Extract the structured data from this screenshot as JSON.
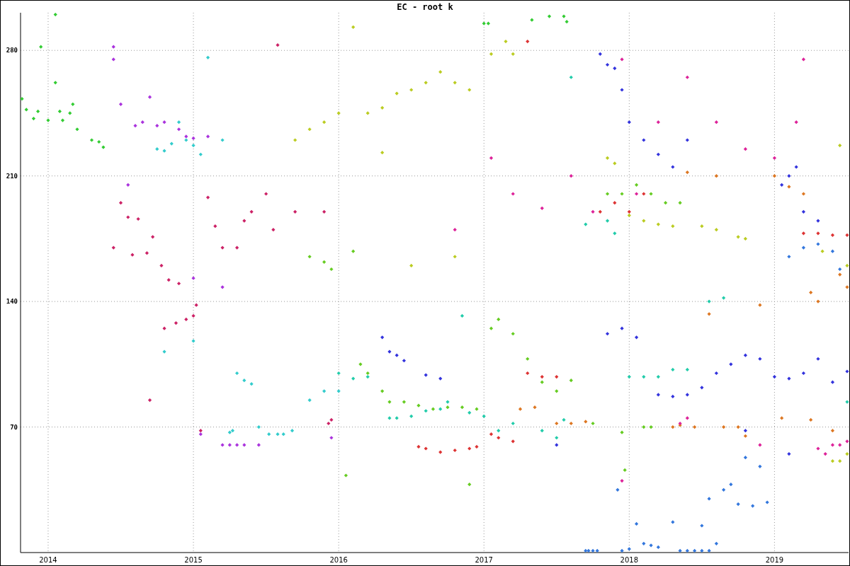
{
  "chart_data": {
    "type": "scatter",
    "title": "EC - root k",
    "xlim": [
      2013.81,
      2019.51
    ],
    "ylim": [
      0,
      301
    ],
    "grid": true,
    "xticks": [
      2014,
      2015,
      2016,
      2017,
      2018,
      2019
    ],
    "yticks": [
      70,
      140,
      210,
      280
    ],
    "series": [
      {
        "color": "#33cc33",
        "x": [
          2013.82,
          2013.85,
          2013.9,
          2013.93,
          2013.95,
          2014.0,
          2014.05,
          2014.1,
          2014.15,
          2014.2,
          2014.08,
          2014.17,
          2014.3,
          2014.35,
          2014.38,
          2014.05,
          2017.0,
          2017.03,
          2017.33,
          2017.45,
          2017.55,
          2017.57
        ],
        "values": [
          253,
          247,
          242,
          246,
          282,
          241,
          300,
          241,
          245,
          236,
          246,
          250,
          230,
          229,
          226,
          262,
          295,
          295,
          297,
          299,
          299,
          296
        ]
      },
      {
        "color": "#aa33dd",
        "x": [
          2014.45,
          2014.45,
          2014.5,
          2014.55,
          2014.6,
          2014.65,
          2014.7,
          2014.75,
          2014.8,
          2014.9,
          2014.95,
          2015.0,
          2015.1,
          2015.0,
          2015.2,
          2015.2,
          2015.25,
          2015.3,
          2015.35,
          2015.45,
          2015.05,
          2015.95
        ],
        "values": [
          275,
          282,
          250,
          205,
          238,
          240,
          254,
          238,
          240,
          236,
          232,
          231,
          232,
          153,
          148,
          60,
          60,
          60,
          60,
          60,
          66,
          64
        ]
      },
      {
        "color": "#cc2266",
        "x": [
          2014.45,
          2014.5,
          2014.55,
          2014.58,
          2014.62,
          2014.68,
          2014.72,
          2014.78,
          2014.83,
          2014.9,
          2014.8,
          2014.88,
          2014.95,
          2015.0,
          2015.02,
          2014.7,
          2015.05,
          2015.1,
          2015.15,
          2015.2,
          2015.3,
          2015.35,
          2015.4,
          2015.5,
          2015.55,
          2015.7,
          2015.9,
          2015.93,
          2015.95,
          2015.58
        ],
        "values": [
          170,
          195,
          187,
          166,
          186,
          167,
          176,
          160,
          152,
          150,
          125,
          128,
          130,
          132,
          138,
          85,
          68,
          198,
          182,
          170,
          170,
          185,
          190,
          200,
          180,
          190,
          190,
          72,
          74,
          283
        ]
      },
      {
        "color": "#33cccc",
        "x": [
          2014.75,
          2014.8,
          2014.85,
          2014.9,
          2014.95,
          2015.0,
          2015.05,
          2015.1,
          2015.2,
          2015.25,
          2015.27,
          2015.3,
          2015.35,
          2015.4,
          2015.45,
          2015.52,
          2015.58,
          2015.62,
          2015.68,
          2015.8,
          2015.9,
          2016.0,
          2014.8,
          2015.0
        ],
        "values": [
          225,
          224,
          228,
          240,
          230,
          227,
          222,
          276,
          230,
          67,
          68,
          100,
          96,
          94,
          70,
          66,
          66,
          66,
          68,
          85,
          90,
          90,
          112,
          118
        ]
      },
      {
        "color": "#bbcc22",
        "x": [
          2015.7,
          2015.8,
          2015.9,
          2016.0,
          2016.1,
          2016.2,
          2016.3,
          2016.4,
          2016.5,
          2016.6,
          2016.7,
          2016.8,
          2016.9,
          2017.05,
          2017.15,
          2017.2,
          2016.3,
          2016.5,
          2016.8,
          2017.85,
          2017.9,
          2018.0,
          2018.1,
          2018.2,
          2018.3,
          2018.5,
          2018.6,
          2018.75,
          2018.8,
          2019.33,
          2019.45,
          2019.5,
          2019.4,
          2019.45,
          2019.5
        ],
        "values": [
          230,
          236,
          240,
          245,
          293,
          245,
          248,
          256,
          258,
          262,
          268,
          262,
          258,
          278,
          285,
          278,
          223,
          160,
          165,
          220,
          217,
          188,
          185,
          183,
          182,
          182,
          180,
          176,
          175,
          168,
          227,
          160,
          51,
          51,
          55
        ]
      },
      {
        "color": "#66cc22",
        "x": [
          2015.8,
          2015.9,
          2015.95,
          2016.1,
          2016.15,
          2016.2,
          2016.3,
          2016.35,
          2016.45,
          2016.55,
          2016.65,
          2016.75,
          2016.85,
          2016.95,
          2017.05,
          2017.1,
          2017.2,
          2017.3,
          2017.4,
          2017.5,
          2017.6,
          2017.75,
          2017.85,
          2017.95,
          2018.05,
          2018.15,
          2018.25,
          2018.35,
          2016.05,
          2016.9,
          2017.95,
          2018.1,
          2018.15,
          2017.97
        ],
        "values": [
          165,
          162,
          158,
          168,
          105,
          100,
          90,
          84,
          84,
          82,
          80,
          81,
          81,
          80,
          125,
          130,
          122,
          108,
          95,
          90,
          96,
          72,
          200,
          200,
          205,
          200,
          195,
          195,
          43,
          38,
          67,
          70,
          70,
          46
        ]
      },
      {
        "color": "#dd3333",
        "x": [
          2016.55,
          2016.6,
          2016.7,
          2016.8,
          2016.9,
          2016.95,
          2017.05,
          2017.1,
          2017.2,
          2017.3,
          2017.4,
          2017.5,
          2017.8,
          2017.9,
          2018.0,
          2018.1,
          2019.2,
          2019.3,
          2019.4,
          2019.5,
          2017.3
        ],
        "values": [
          59,
          58,
          56,
          57,
          58,
          59,
          66,
          64,
          62,
          100,
          98,
          98,
          190,
          195,
          190,
          200,
          178,
          178,
          177,
          177,
          285
        ]
      },
      {
        "color": "#dd7722",
        "x": [
          2017.25,
          2017.35,
          2017.5,
          2017.6,
          2017.7,
          2018.3,
          2018.35,
          2018.45,
          2018.55,
          2018.65,
          2018.75,
          2018.8,
          2018.9,
          2019.0,
          2019.1,
          2019.2,
          2019.25,
          2019.3,
          2019.4,
          2019.45,
          2019.5,
          2018.4,
          2018.6,
          2019.05,
          2019.25
        ],
        "values": [
          80,
          81,
          72,
          72,
          73,
          70,
          71,
          70,
          133,
          70,
          70,
          65,
          138,
          210,
          204,
          200,
          145,
          140,
          68,
          155,
          148,
          212,
          210,
          75,
          74
        ]
      },
      {
        "color": "#3333dd",
        "x": [
          2016.3,
          2016.35,
          2016.4,
          2016.45,
          2016.6,
          2016.7,
          2017.5,
          2017.8,
          2017.85,
          2017.9,
          2017.95,
          2018.0,
          2018.1,
          2018.2,
          2018.3,
          2018.4,
          2017.85,
          2017.95,
          2018.05,
          2018.2,
          2018.3,
          2018.4,
          2018.5,
          2018.6,
          2018.7,
          2018.8,
          2018.9,
          2019.0,
          2019.1,
          2019.2,
          2019.3,
          2019.4,
          2019.5,
          2019.05,
          2019.1,
          2019.15,
          2019.2,
          2019.3,
          2018.8,
          2019.1
        ],
        "values": [
          120,
          112,
          110,
          107,
          99,
          97,
          60,
          278,
          272,
          270,
          258,
          240,
          230,
          222,
          215,
          230,
          122,
          125,
          120,
          88,
          87,
          88,
          92,
          100,
          105,
          110,
          108,
          98,
          97,
          100,
          108,
          95,
          101,
          205,
          210,
          215,
          190,
          185,
          68,
          55
        ]
      },
      {
        "color": "#3377dd",
        "x": [
          2017.7,
          2017.72,
          2017.75,
          2017.78,
          2017.95,
          2018.0,
          2017.92,
          2018.05,
          2018.1,
          2018.15,
          2018.2,
          2018.3,
          2018.35,
          2018.4,
          2018.45,
          2018.5,
          2018.55,
          2018.5,
          2018.55,
          2018.6,
          2018.65,
          2018.7,
          2018.8,
          2018.9,
          2018.95,
          2019.1,
          2019.2,
          2019.3,
          2019.4,
          2019.45,
          2018.75,
          2018.85
        ],
        "values": [
          1,
          1,
          1,
          1,
          1,
          2,
          35,
          16,
          5,
          4,
          3,
          17,
          1,
          1,
          1,
          1,
          1,
          15,
          30,
          5,
          35,
          38,
          53,
          48,
          28,
          165,
          170,
          172,
          168,
          158,
          27,
          26
        ]
      },
      {
        "color": "#dd2299",
        "x": [
          2016.8,
          2017.05,
          2017.2,
          2017.4,
          2017.6,
          2017.75,
          2017.95,
          2018.05,
          2018.2,
          2018.4,
          2018.6,
          2018.8,
          2019.0,
          2019.15,
          2019.3,
          2019.35,
          2019.4,
          2019.45,
          2019.5,
          2018.9,
          2017.95,
          2018.35,
          2018.4,
          2019.2
        ],
        "values": [
          180,
          220,
          200,
          192,
          210,
          190,
          275,
          200,
          240,
          265,
          240,
          225,
          220,
          240,
          58,
          55,
          60,
          60,
          62,
          60,
          40,
          72,
          75,
          275
        ]
      },
      {
        "color": "#22ccaa",
        "x": [
          2016.35,
          2016.4,
          2016.5,
          2016.6,
          2016.7,
          2016.75,
          2016.9,
          2017.0,
          2017.1,
          2017.2,
          2017.4,
          2017.5,
          2017.55,
          2017.7,
          2017.85,
          2018.0,
          2018.1,
          2018.2,
          2018.3,
          2018.4,
          2018.55,
          2018.65,
          2019.5,
          2016.2,
          2016.0,
          2016.1,
          2016.85,
          2017.9,
          2017.6
        ],
        "values": [
          75,
          75,
          76,
          79,
          80,
          84,
          78,
          76,
          68,
          72,
          68,
          64,
          74,
          183,
          185,
          98,
          98,
          98,
          102,
          102,
          140,
          142,
          84,
          98,
          100,
          97,
          132,
          178,
          265
        ]
      }
    ]
  }
}
